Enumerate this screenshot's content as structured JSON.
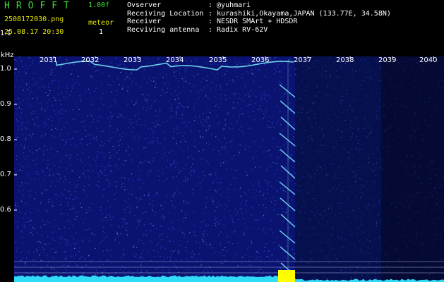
{
  "header": {
    "brand": "HROFFT",
    "version": "1.00f",
    "filename": "2508172030.png",
    "datetime": "25.08.17 20:30",
    "meteor_label": "meteor",
    "meteor_count": "1",
    "info": [
      {
        "key": "Ovserver",
        "value": ": @yuhmari"
      },
      {
        "key": "Receiving Location",
        "value": ": kurashiki,Okayama,JAPAN (133.77E, 34.58N)"
      },
      {
        "key": "Receiver",
        "value": ": NESDR SMArt + HDSDR"
      },
      {
        "key": "Recviving antenna",
        "value": ": Radix RV-62V"
      }
    ]
  },
  "chart_data": {
    "type": "heatmap",
    "y_unit": "kHz",
    "y_ticks": [
      "1.1",
      "1.0",
      "0.9",
      "0.8",
      "0.7",
      "0.6"
    ],
    "x_ticks": [
      "2031",
      "2032",
      "2033",
      "2034",
      "2035",
      "2036",
      "2037",
      "2038",
      "2039",
      "2040"
    ],
    "colors": {
      "background": "#0a1470",
      "noise": "#3c5aff",
      "signal": "#7cf0ff",
      "level": "#33e6ff",
      "marker": "#ffff00"
    }
  }
}
